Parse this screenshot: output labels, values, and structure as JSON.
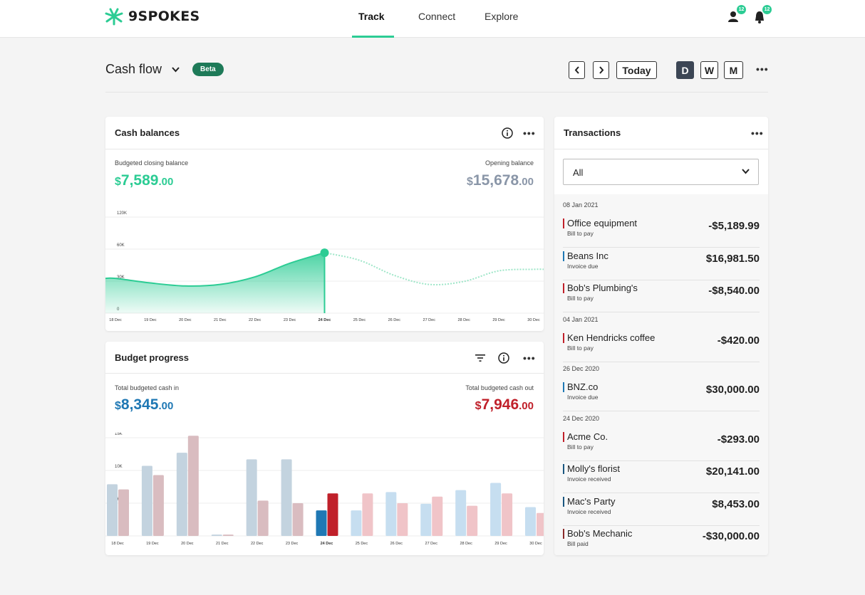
{
  "brand": {
    "name": "9SPOKES",
    "accent": "#2ccc94"
  },
  "nav": {
    "tabs": [
      {
        "label": "Track",
        "active": true
      },
      {
        "label": "Connect",
        "active": false
      },
      {
        "label": "Explore",
        "active": false
      }
    ],
    "user_badge": "12",
    "bell_badge": "12"
  },
  "header": {
    "title": "Cash flow",
    "beta": "Beta",
    "prev": "‹",
    "next": "›",
    "today": "Today",
    "views": [
      "D",
      "W",
      "M"
    ],
    "selected_view": "D",
    "more": "•••"
  },
  "cash_balances": {
    "title": "Cash balances",
    "more": "•••",
    "closing_label": "Budgeted closing balance",
    "closing_dollar": "$",
    "closing_whole": "7,589",
    "closing_cents": ".00",
    "opening_label": "Opening balance",
    "opening_dollar": "$",
    "opening_whole": "15,678",
    "opening_cents": ".00",
    "colors": {
      "closing": "#2ccc94",
      "opening": "#8a96a8"
    }
  },
  "budget_progress": {
    "title": "Budget progress",
    "more": "•••",
    "in_label": "Total budgeted cash in",
    "in_dollar": "$",
    "in_whole": "8,345",
    "in_cents": ".00",
    "out_label": "Total budgeted cash out",
    "out_dollar": "$",
    "out_whole": "7,946",
    "out_cents": ".00",
    "colors": {
      "in": "#1f78b4",
      "out": "#c0202a"
    }
  },
  "chart_data": [
    {
      "type": "area",
      "categories": [
        "18 Dec",
        "19 Dec",
        "20 Dec",
        "21 Dec",
        "22 Dec",
        "23 Dec",
        "24 Dec",
        "25 Dec",
        "26 Dec",
        "27 Dec",
        "28 Dec",
        "29 Dec",
        "30 Dec"
      ],
      "highlight": "24 Dec",
      "y_ticks": [
        "0",
        "30K",
        "60K",
        "120K"
      ],
      "ylim": [
        0,
        130000
      ],
      "series": [
        {
          "values": [
            46000,
            40000,
            36000,
            38000,
            48000,
            66000,
            80000,
            70000,
            50000,
            38000,
            42000,
            56000,
            58000
          ]
        }
      ],
      "actual_until": "24 Dec"
    },
    {
      "type": "bar",
      "categories": [
        "18 Dec",
        "19 Dec",
        "20 Dec",
        "21 Dec",
        "22 Dec",
        "23 Dec",
        "24 Dec",
        "25 Dec",
        "26 Dec",
        "27 Dec",
        "28 Dec",
        "29 Dec",
        "30 Dec"
      ],
      "highlight": "24 Dec",
      "y_ticks": [
        "0",
        "5K",
        "10K",
        "15K"
      ],
      "ylim": [
        0,
        15000
      ],
      "series": [
        {
          "values": [
            7900,
            10700,
            12700,
            200,
            11700,
            11700,
            3900,
            3900,
            6700,
            4900,
            7000,
            8100,
            4400
          ]
        },
        {
          "values": [
            7100,
            9300,
            15300,
            200,
            5400,
            5000,
            6500,
            6500,
            5000,
            6000,
            4600,
            6500,
            3500
          ]
        }
      ]
    }
  ],
  "transactions": {
    "title": "Transactions",
    "more": "•••",
    "filter_value": "All",
    "groups": [
      {
        "date": "08 Jan 2021",
        "items": [
          {
            "name": "Office equipment",
            "sub": "Bill to pay",
            "amount": "-$5,189.99",
            "kind": "out"
          },
          {
            "name": "Beans Inc",
            "sub": "Invoice due",
            "amount": "$16,981.50",
            "kind": "in"
          },
          {
            "name": "Bob's Plumbing's",
            "sub": "Bill to pay",
            "amount": "-$8,540.00",
            "kind": "out"
          }
        ]
      },
      {
        "date": "04 Jan 2021",
        "items": [
          {
            "name": "Ken Hendricks coffee",
            "sub": "Bill to pay",
            "amount": "-$420.00",
            "kind": "out"
          }
        ]
      },
      {
        "date": "26 Dec 2020",
        "items": [
          {
            "name": "BNZ.co",
            "sub": "Invoice due",
            "amount": "$30,000.00",
            "kind": "in"
          }
        ]
      },
      {
        "date": "24 Dec 2020",
        "items": [
          {
            "name": "Acme Co.",
            "sub": "Bill to pay",
            "amount": "-$293.00",
            "kind": "out"
          },
          {
            "name": "Molly's florist",
            "sub": "Invoice received",
            "amount": "$20,141.00",
            "kind": "in-dark"
          },
          {
            "name": "Mac's Party",
            "sub": "Invoice received",
            "amount": "$8,453.00",
            "kind": "in-dark"
          },
          {
            "name": "Bob's Mechanic",
            "sub": "Bill paid",
            "amount": "-$30,000.00",
            "kind": "out-dark"
          }
        ]
      }
    ]
  }
}
